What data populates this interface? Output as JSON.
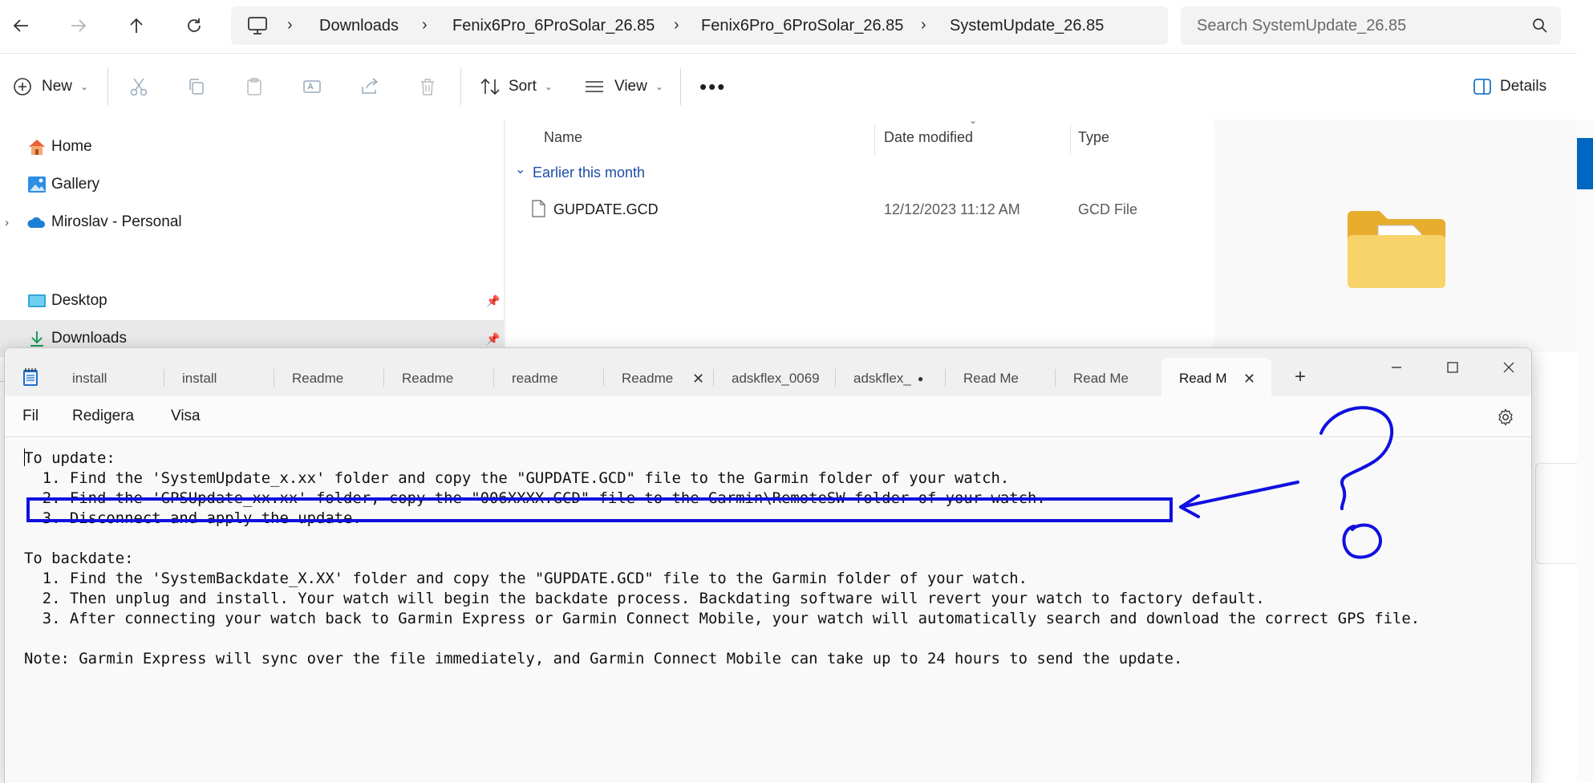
{
  "explorer": {
    "breadcrumb": [
      "Downloads",
      "Fenix6Pro_6ProSolar_26.85",
      "Fenix6Pro_6ProSolar_26.85",
      "SystemUpdate_26.85"
    ],
    "search_placeholder": "Search SystemUpdate_26.85",
    "toolbar": {
      "new_label": "New",
      "sort_label": "Sort",
      "view_label": "View",
      "details_label": "Details"
    },
    "nav": {
      "home": "Home",
      "gallery": "Gallery",
      "onedrive": "Miroslav - Personal",
      "desktop": "Desktop",
      "downloads": "Downloads"
    },
    "columns": {
      "name": "Name",
      "date": "Date modified",
      "type": "Type"
    },
    "group_label": "Earlier this month",
    "files": [
      {
        "name": "GUPDATE.GCD",
        "date": "12/12/2023 11:12 AM",
        "type": "GCD File"
      }
    ]
  },
  "notepad": {
    "tabs": [
      "install",
      "install",
      "Readme",
      "Readme",
      "readme",
      "Readme",
      "adskflex_0069",
      "adskflex_",
      "Read Me",
      "Read Me",
      "Read M"
    ],
    "new_tab_glyph": "+",
    "menu": {
      "file": "Fil",
      "edit": "Redigera",
      "view": "Visa"
    },
    "lines": [
      "To update:",
      "  1. Find the 'SystemUpdate_x.xx' folder and copy the \"GUPDATE.GCD\" file to the Garmin folder of your watch.",
      "  2. Find the 'GPSUpdate_xx.xx' folder, copy the \"006XXXX.GCD\" file to the Garmin\\RemoteSW folder of your watch.",
      "  3. Disconnect and apply the update.",
      "",
      "To backdate:",
      "  1. Find the 'SystemBackdate_X.XX' folder and copy the \"GUPDATE.GCD\" file to the Garmin folder of your watch.",
      "  2. Then unplug and install. Your watch will begin the backdate process. Backdating software will revert your watch to factory default.",
      "  3. After connecting your watch back to Garmin Express or Garmin Connect Mobile, your watch will automatically search and download the correct GPS file.",
      "",
      "Note: Garmin Express will sync over the file immediately, and Garmin Connect Mobile can take up to 24 hours to send the update."
    ]
  },
  "colors": {
    "annotation": "#1010e0",
    "accent": "#0067c0",
    "folder": "#f4c64c"
  }
}
